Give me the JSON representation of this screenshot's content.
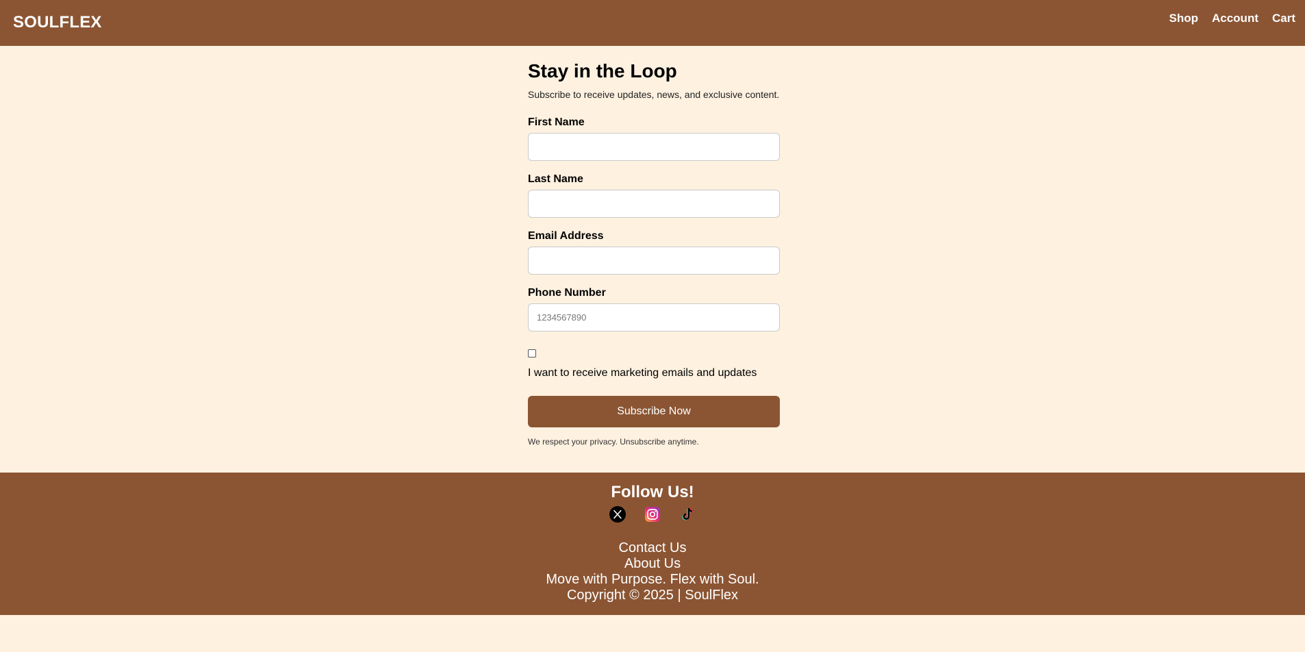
{
  "header": {
    "brand": "SOULFLEX",
    "nav": [
      "Shop",
      "Account",
      "Cart"
    ]
  },
  "form": {
    "title": "Stay in the Loop",
    "subtitle": "Subscribe to receive updates, news, and exclusive content.",
    "fields": [
      {
        "label": "First Name",
        "value": "",
        "placeholder": ""
      },
      {
        "label": "Last Name",
        "value": "",
        "placeholder": ""
      },
      {
        "label": "Email Address",
        "value": "",
        "placeholder": ""
      },
      {
        "label": "Phone Number",
        "value": "",
        "placeholder": "1234567890"
      }
    ],
    "marketing_checkbox": {
      "checked": false,
      "label": "I want to receive marketing emails and updates"
    },
    "submit_label": "Subscribe Now",
    "privacy_note": "We respect your privacy. Unsubscribe anytime."
  },
  "footer": {
    "follow_title": "Follow Us!",
    "socials": [
      "x-icon",
      "instagram-icon",
      "tiktok-icon"
    ],
    "links": [
      "Contact Us",
      "About Us"
    ],
    "tagline": "Move with Purpose. Flex with Soul.",
    "copyright": "Copyright © 2025 | SoulFlex"
  },
  "colors": {
    "brand_brown": "#8b5533",
    "page_background": "#fef1e0"
  }
}
